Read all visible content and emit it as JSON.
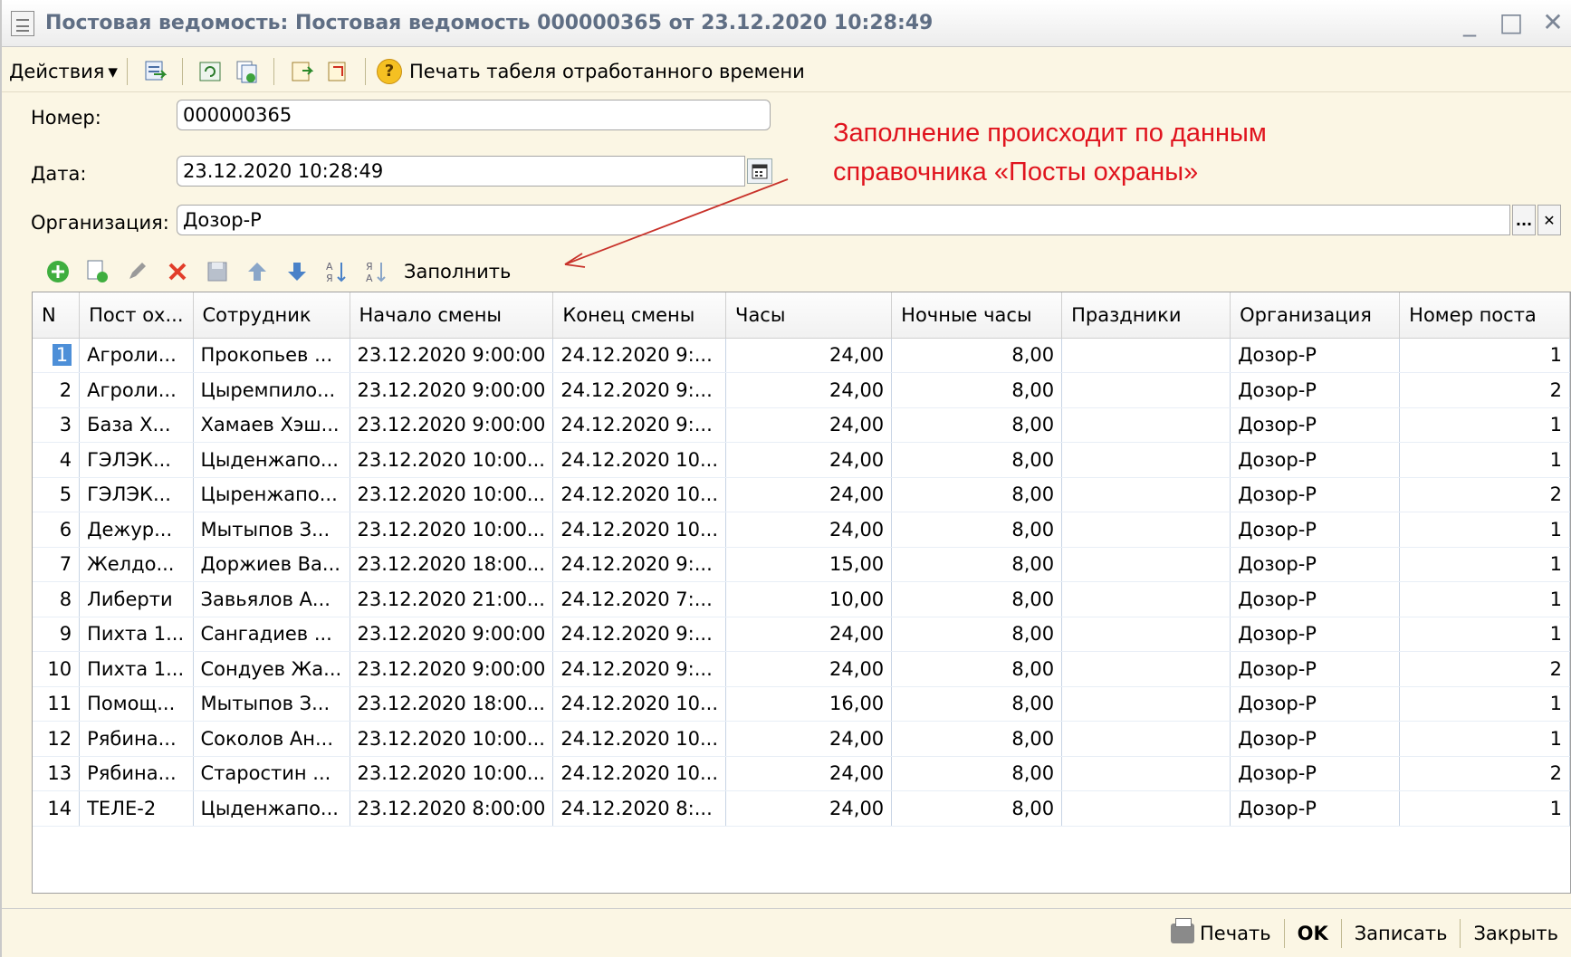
{
  "window": {
    "title": "Постовая ведомость: Постовая ведомость 000000365 от 23.12.2020 10:28:49",
    "controls": [
      "_",
      "□",
      "✕"
    ]
  },
  "toolbar": {
    "actions_label": "Действия",
    "actions_arrow": "▾",
    "help_glyph": "?",
    "print_timesheet_label": "Печать табеля отработанного времени"
  },
  "form": {
    "number_label": "Номер:",
    "number_value": "000000365",
    "date_label": "Дата:",
    "date_value": "23.12.2020 10:28:49",
    "org_label": "Организация:",
    "org_value": "Дозор-Р",
    "org_select_glyph": "...",
    "org_clear_glyph": "✕"
  },
  "annotation": {
    "line1": "Заполнение происходит по данным",
    "line2": "справочника «Посты охраны»",
    "color": "#e0141e"
  },
  "table_toolbar": {
    "fill_label": "Заполнить"
  },
  "table": {
    "headers": [
      "N",
      "Пост ох...",
      "Сотрудник",
      "Начало смены",
      "Конец смены",
      "Часы",
      "Ночные часы",
      "Праздники",
      "Организация",
      "Номер поста"
    ],
    "selected_row": 0,
    "rows": [
      [
        "1",
        "Агроли...",
        "Прокопьев ...",
        "23.12.2020 9:00:00",
        "24.12.2020 9:...",
        "24,00",
        "8,00",
        "",
        "Дозор-Р",
        "1"
      ],
      [
        "2",
        "Агроли...",
        "Цыремпило...",
        "23.12.2020 9:00:00",
        "24.12.2020 9:...",
        "24,00",
        "8,00",
        "",
        "Дозор-Р",
        "2"
      ],
      [
        "3",
        "База Х...",
        "Хамаев Хэш...",
        "23.12.2020 9:00:00",
        "24.12.2020 9:...",
        "24,00",
        "8,00",
        "",
        "Дозор-Р",
        "1"
      ],
      [
        "4",
        "ГЭЛЭК...",
        "Цыденжапо...",
        "23.12.2020 10:00...",
        "24.12.2020 10...",
        "24,00",
        "8,00",
        "",
        "Дозор-Р",
        "1"
      ],
      [
        "5",
        "ГЭЛЭК...",
        "Цыренжапо...",
        "23.12.2020 10:00...",
        "24.12.2020 10...",
        "24,00",
        "8,00",
        "",
        "Дозор-Р",
        "2"
      ],
      [
        "6",
        "Дежур...",
        "Мытыпов З...",
        "23.12.2020 10:00...",
        "24.12.2020 10...",
        "24,00",
        "8,00",
        "",
        "Дозор-Р",
        "1"
      ],
      [
        "7",
        "Желдо...",
        "Доржиев Ва...",
        "23.12.2020 18:00...",
        "24.12.2020 9:...",
        "15,00",
        "8,00",
        "",
        "Дозор-Р",
        "1"
      ],
      [
        "8",
        "Либерти",
        "Завьялов А...",
        "23.12.2020 21:00...",
        "24.12.2020 7:...",
        "10,00",
        "8,00",
        "",
        "Дозор-Р",
        "1"
      ],
      [
        "9",
        "Пихта 1...",
        "Сангадиев ...",
        "23.12.2020 9:00:00",
        "24.12.2020 9:...",
        "24,00",
        "8,00",
        "",
        "Дозор-Р",
        "1"
      ],
      [
        "10",
        "Пихта 1...",
        "Сондуев Жа...",
        "23.12.2020 9:00:00",
        "24.12.2020 9:...",
        "24,00",
        "8,00",
        "",
        "Дозор-Р",
        "2"
      ],
      [
        "11",
        "Помощ...",
        "Мытыпов З...",
        "23.12.2020 18:00...",
        "24.12.2020 10...",
        "16,00",
        "8,00",
        "",
        "Дозор-Р",
        "1"
      ],
      [
        "12",
        "Рябина...",
        "Соколов Ан...",
        "23.12.2020 10:00...",
        "24.12.2020 10...",
        "24,00",
        "8,00",
        "",
        "Дозор-Р",
        "1"
      ],
      [
        "13",
        "Рябина...",
        "Старостин ...",
        "23.12.2020 10:00...",
        "24.12.2020 10...",
        "24,00",
        "8,00",
        "",
        "Дозор-Р",
        "2"
      ],
      [
        "14",
        "ТЕЛЕ-2",
        "Цыденжапо...",
        "23.12.2020 8:00:00",
        "24.12.2020 8:...",
        "24,00",
        "8,00",
        "",
        "Дозор-Р",
        "1"
      ]
    ]
  },
  "statusbar": {
    "print_label": "Печать",
    "ok_label": "OK",
    "save_label": "Записать",
    "close_label": "Закрыть"
  }
}
